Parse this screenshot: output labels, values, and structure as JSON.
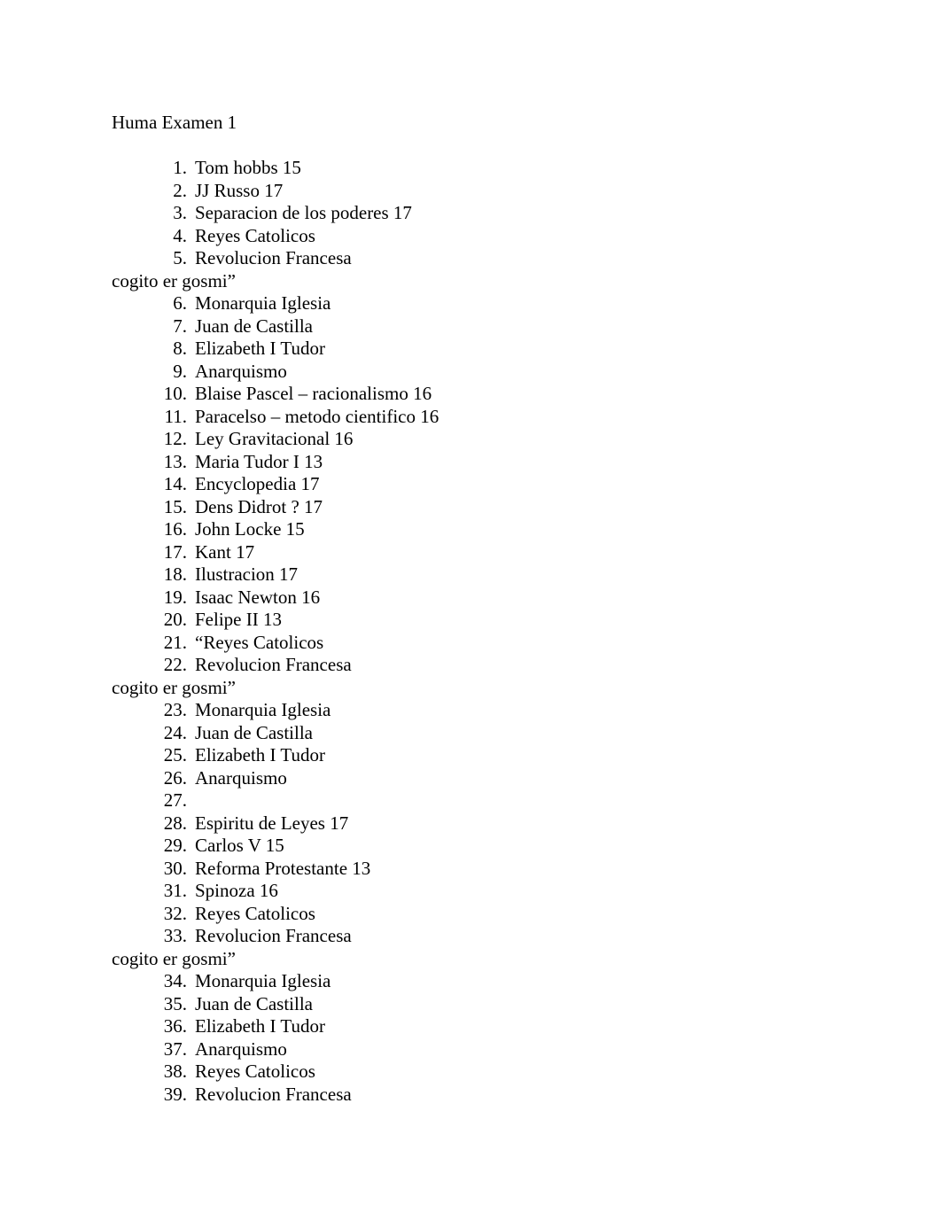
{
  "document": {
    "title": "Huma Examen 1",
    "blocks": [
      {
        "kind": "title",
        "text": "Huma Examen 1"
      },
      {
        "kind": "spacer",
        "text": ""
      },
      {
        "kind": "item",
        "number": "1.",
        "text": "Tom hobbs 15"
      },
      {
        "kind": "item",
        "number": "2.",
        "text": "JJ Russo 17"
      },
      {
        "kind": "item",
        "number": "3.",
        "text": "Separacion de los poderes 17"
      },
      {
        "kind": "item",
        "number": "4.",
        "text": "Reyes Catolicos"
      },
      {
        "kind": "item",
        "number": "5.",
        "text": "Revolucion Francesa"
      },
      {
        "kind": "flush",
        "text": "cogito er gosmi”"
      },
      {
        "kind": "item",
        "number": "6.",
        "text": "Monarquia Iglesia"
      },
      {
        "kind": "item",
        "number": "7.",
        "text": "Juan de Castilla"
      },
      {
        "kind": "item",
        "number": "8.",
        "text": "Elizabeth I Tudor"
      },
      {
        "kind": "item",
        "number": "9.",
        "text": "Anarquismo"
      },
      {
        "kind": "item",
        "number": "10.",
        "text": "Blaise Pascel – racionalismo 16"
      },
      {
        "kind": "item",
        "number": "11.",
        "text": "Paracelso – metodo cientifico 16"
      },
      {
        "kind": "item",
        "number": "12.",
        "text": "Ley Gravitacional 16"
      },
      {
        "kind": "item",
        "number": "13.",
        "text": "Maria Tudor I 13"
      },
      {
        "kind": "item",
        "number": "14.",
        "text": "Encyclopedia 17"
      },
      {
        "kind": "item",
        "number": "15.",
        "text": "Dens Didrot ? 17"
      },
      {
        "kind": "item",
        "number": "16.",
        "text": "John Locke 15"
      },
      {
        "kind": "item",
        "number": "17.",
        "text": "Kant 17"
      },
      {
        "kind": "item",
        "number": "18.",
        "text": "Ilustracion 17"
      },
      {
        "kind": "item",
        "number": "19.",
        "text": "Isaac Newton 16"
      },
      {
        "kind": "item",
        "number": "20.",
        "text": "Felipe II 13"
      },
      {
        "kind": "item",
        "number": "21.",
        "text": "“Reyes Catolicos"
      },
      {
        "kind": "item",
        "number": "22.",
        "text": "Revolucion Francesa"
      },
      {
        "kind": "flush",
        "text": "cogito er gosmi”"
      },
      {
        "kind": "item",
        "number": "23.",
        "text": "Monarquia Iglesia"
      },
      {
        "kind": "item",
        "number": "24.",
        "text": "Juan de Castilla"
      },
      {
        "kind": "item",
        "number": "25.",
        "text": "Elizabeth I Tudor"
      },
      {
        "kind": "item",
        "number": "26.",
        "text": "Anarquismo"
      },
      {
        "kind": "item",
        "number": "27.",
        "text": ""
      },
      {
        "kind": "item",
        "number": "28.",
        "text": "Espiritu de Leyes 17"
      },
      {
        "kind": "item",
        "number": "29.",
        "text": "Carlos V 15"
      },
      {
        "kind": "item",
        "number": "30.",
        "text": "Reforma Protestante 13"
      },
      {
        "kind": "item",
        "number": "31.",
        "text": "Spinoza 16"
      },
      {
        "kind": "item",
        "number": "32.",
        "text": "Reyes Catolicos"
      },
      {
        "kind": "item",
        "number": "33.",
        "text": "Revolucion Francesa"
      },
      {
        "kind": "flush",
        "text": "cogito er gosmi”"
      },
      {
        "kind": "item",
        "number": "34.",
        "text": "Monarquia Iglesia"
      },
      {
        "kind": "item",
        "number": "35.",
        "text": "Juan de Castilla"
      },
      {
        "kind": "item",
        "number": "36.",
        "text": "Elizabeth I Tudor"
      },
      {
        "kind": "item",
        "number": "37.",
        "text": "Anarquismo"
      },
      {
        "kind": "item",
        "number": "38.",
        "text": "Reyes Catolicos"
      },
      {
        "kind": "item",
        "number": "39.",
        "text": "Revolucion Francesa"
      }
    ]
  },
  "style": {
    "text_color": "#000000",
    "page_color": "#ffffff"
  }
}
